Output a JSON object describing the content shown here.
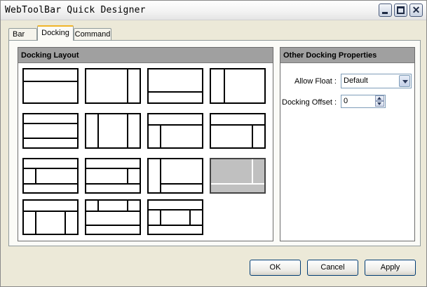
{
  "window": {
    "title": "WebToolBar Quick Designer",
    "controls": {
      "minimize": "minimize",
      "maximize": "maximize",
      "close_glyph": "✕"
    }
  },
  "tabs": [
    {
      "label": "Bar",
      "selected": false
    },
    {
      "label": "Docking",
      "selected": true
    },
    {
      "label": "Command",
      "selected": false
    }
  ],
  "docking_layout": {
    "header": "Docking Layout",
    "selected_index": 11,
    "layout_count": 15
  },
  "other_props": {
    "header": "Other Docking Properties",
    "allow_float": {
      "label": "Allow Float :",
      "value": "Default"
    },
    "docking_offset": {
      "label": "Docking Offset :",
      "value": "0"
    }
  },
  "buttons": {
    "ok": "OK",
    "cancel": "Cancel",
    "apply": "Apply"
  },
  "colors": {
    "header_bg": "#a0a0a0",
    "active_tab_accent": "#f0b428",
    "window_bg": "#ece9d8",
    "selected_thumb": "#c0c0c0"
  }
}
